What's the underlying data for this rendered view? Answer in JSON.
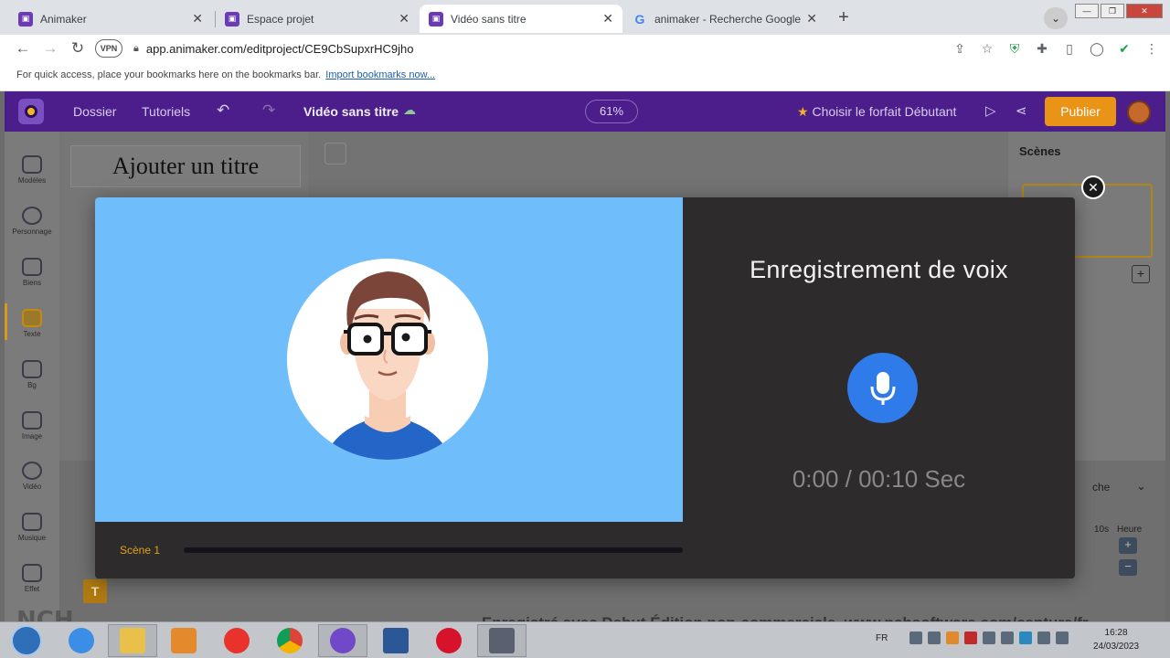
{
  "browser": {
    "tabs": [
      {
        "title": "Animaker",
        "close": "✕"
      },
      {
        "title": "Espace projet",
        "close": "✕"
      },
      {
        "title": "Vidéo sans titre",
        "close": "✕"
      },
      {
        "title": "animaker - Recherche Google",
        "close": "✕"
      }
    ],
    "new_tab": "+",
    "vpn": "VPN",
    "url": "app.animaker.com/editproject/CE9CbSupxrHC9jho",
    "bookmarks_text": "For quick access, place your bookmarks here on the bookmarks bar.",
    "bookmarks_link": "Import bookmarks now..."
  },
  "app_header": {
    "folder": "Dossier",
    "tutorials": "Tutoriels",
    "project_title": "Vidéo sans titre",
    "zoom": "61%",
    "plan": "Choisir le forfait Débutant",
    "publish": "Publier"
  },
  "left_rail": [
    {
      "label": "Modèles"
    },
    {
      "label": "Personnage"
    },
    {
      "label": "Biens"
    },
    {
      "label": "Texte"
    },
    {
      "label": "Bg"
    },
    {
      "label": "Image"
    },
    {
      "label": "Vidéo"
    },
    {
      "label": "Musique"
    },
    {
      "label": "Effet"
    }
  ],
  "text_panel": {
    "title_card": "Ajouter un titre"
  },
  "scenes_panel": {
    "title": "Scènes",
    "add": "+"
  },
  "timeline": {
    "time_10s": "10s",
    "hour": "Heure",
    "partial": "che",
    "t_block": "T"
  },
  "modal": {
    "title": "Enregistrement de voix",
    "timer": "0:00 / 00:10 Sec",
    "scene_label": "Scène 1",
    "progress": 0,
    "close": "✕"
  },
  "watermark": "Enregistré avec Debut Édition non-commerciale. www.nchsoftware.com/capture/fr",
  "taskbar": {
    "lang": "FR",
    "time": "16:28",
    "date": "24/03/2023"
  },
  "colors": {
    "header": "#4b1e8c",
    "publish": "#e99317",
    "modal_bg": "#2e2b2c",
    "preview_bg": "#70bdfc",
    "mic": "#2f7be9",
    "accent": "#e3a21b"
  }
}
